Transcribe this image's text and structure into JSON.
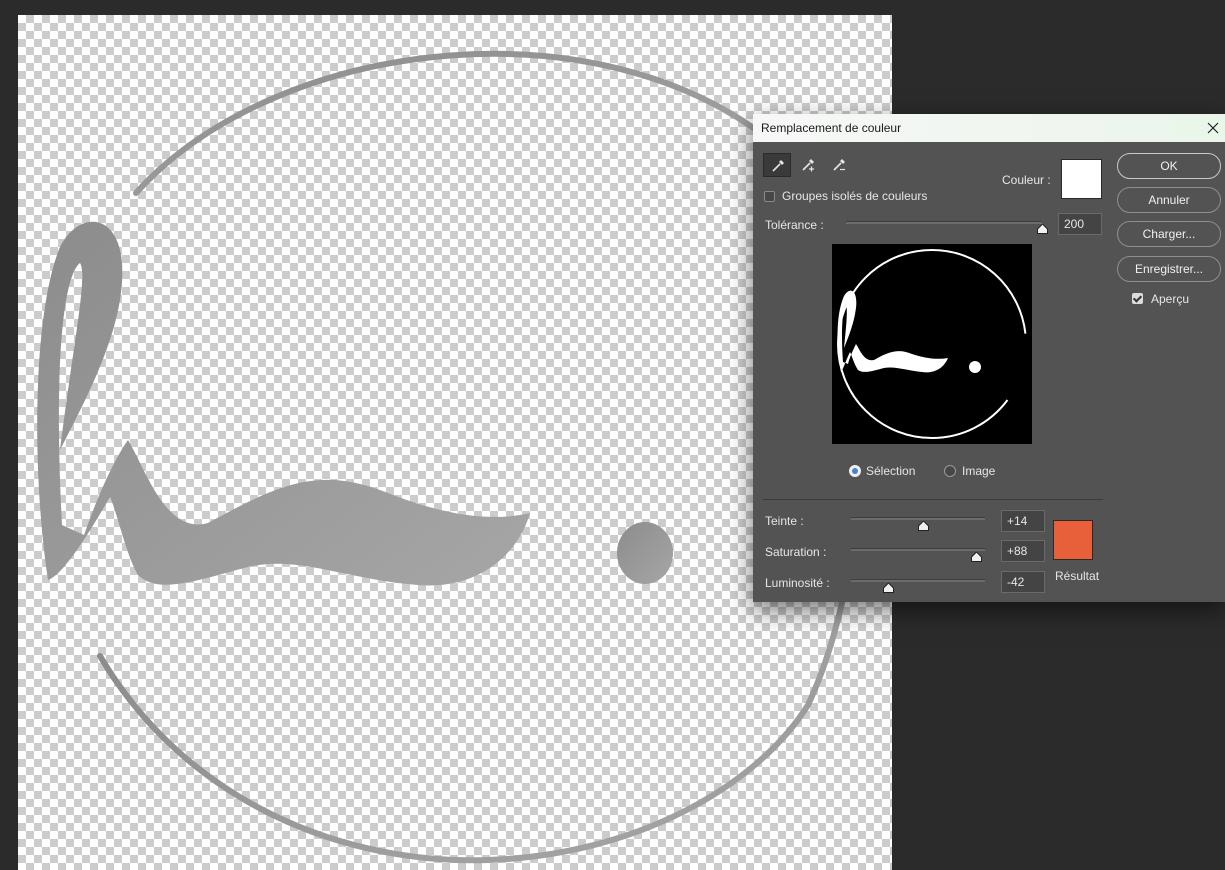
{
  "dialog": {
    "title": "Remplacement de couleur",
    "localized_groups_label": "Groupes isolés de couleurs",
    "localized_groups_checked": false,
    "color_label": "Couleur :",
    "color_swatch": "#ffffff",
    "tolerance": {
      "label": "Tolérance :",
      "value": "200",
      "fraction": 1.0
    },
    "preview_mode": {
      "selection_label": "Sélection",
      "image_label": "Image",
      "selected": "selection"
    },
    "replacement": {
      "hue": {
        "label": "Teinte :",
        "value": "+14",
        "fraction": 0.54
      },
      "saturation": {
        "label": "Saturation :",
        "value": "+88",
        "fraction": 0.94
      },
      "lightness": {
        "label": "Luminosité :",
        "value": "-42",
        "fraction": 0.28
      },
      "result_label": "Résultat",
      "result_color": "#e8603a"
    },
    "buttons": {
      "ok": "OK",
      "cancel": "Annuler",
      "load": "Charger...",
      "save": "Enregistrer..."
    },
    "preview_checkbox": {
      "label": "Aperçu",
      "checked": true
    },
    "tools": [
      "eyedropper-icon",
      "eyedropper-plus-icon",
      "eyedropper-minus-icon"
    ]
  },
  "canvas": {
    "logo_color": "#9a9a9a"
  }
}
